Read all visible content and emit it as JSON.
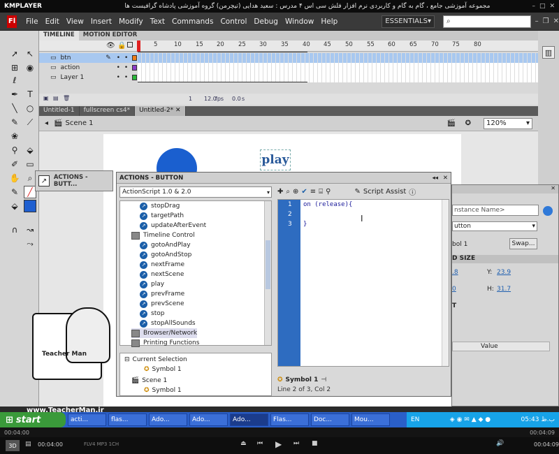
{
  "player": {
    "logo": "KMPLAYER",
    "caption": "مجموعه آموزشی جامع ، گام به گام و کاربردی نرم افزار فلش سی اس ۴ مدرس : سعید هدایی (تیچرمن) گروه آموزشی پادشاه گرافیست ها",
    "time_left": "00:04:00",
    "time_right": "00:04:09",
    "elapsed": "00:04:00",
    "codec": "FLV4 MP3 1CH"
  },
  "menu": {
    "logo": "Fl",
    "items": [
      "File",
      "Edit",
      "View",
      "Insert",
      "Modify",
      "Text",
      "Commands",
      "Control",
      "Debug",
      "Window",
      "Help"
    ],
    "workspace": "ESSENTIALS"
  },
  "timeline": {
    "tab1": "TIMELINE",
    "tab2": "MOTION EDITOR",
    "frame_numbers": [
      "5",
      "10",
      "15",
      "20",
      "25",
      "30",
      "35",
      "40",
      "45",
      "50",
      "55",
      "60",
      "65",
      "70",
      "75",
      "80"
    ],
    "layers": [
      {
        "name": "btn",
        "color": "#f07d1a"
      },
      {
        "name": "action",
        "color": "#8c3cc8"
      },
      {
        "name": "Layer 1",
        "color": "#2ab93a"
      }
    ],
    "current_frame": "1",
    "fps": "12.0",
    "fps_unit": "fps",
    "time": "0.0",
    "time_unit": "s"
  },
  "doc_tabs": [
    "Untitled-1",
    "fullscreen cs4*",
    "Untitled-2*"
  ],
  "scene": "Scene 1",
  "zoom": "120%",
  "stage": {
    "button_text": "play"
  },
  "actions_mini": {
    "title": "ACTIONS - BUTT..."
  },
  "actions": {
    "title": "ACTIONS - BUTTON",
    "version": "ActionScript 1.0 & 2.0",
    "script_assist": "Script Assist",
    "items": [
      "stopDrag",
      "targetPath",
      "updateAfterEvent"
    ],
    "category": "Timeline Control",
    "timeline_items": [
      "gotoAndPlay",
      "gotoAndStop",
      "nextFrame",
      "nextScene",
      "play",
      "prevFrame",
      "prevScene",
      "stop",
      "stopAllSounds"
    ],
    "categories2": [
      "Browser/Network",
      "Printing Functions"
    ],
    "tree": [
      "Current Selection",
      "Symbol 1",
      "Scene 1",
      "Symbol 1"
    ],
    "code_lines": [
      "on (release){",
      "",
      "}"
    ],
    "line_numbers": [
      "1",
      "2",
      "3"
    ],
    "code_tab": "Symbol 1",
    "status": "Line 2 of 3, Col 2"
  },
  "properties": {
    "instance": "nstance Name>",
    "type": "utton",
    "symbol": "bol 1",
    "swap": "Swap...",
    "section": "D SIZE",
    "y_label": "Y:",
    "y_value": "23.9",
    "h_label": "H:",
    "h_value": "31.7",
    "x_frag": ".8",
    "w_frag": "0",
    "value_col": "Value",
    "sec2": "T"
  },
  "taskbar": {
    "start": "start",
    "items": [
      "acti...",
      "flas...",
      "Ado...",
      "Ado...",
      "Ado...",
      "Flas...",
      "Doc...",
      "Mou..."
    ],
    "lang": "EN",
    "clock": "05:43 ب.ظ"
  },
  "watermark": {
    "site": "www.TeacherMan.ir",
    "brand": "Teacher Man"
  }
}
